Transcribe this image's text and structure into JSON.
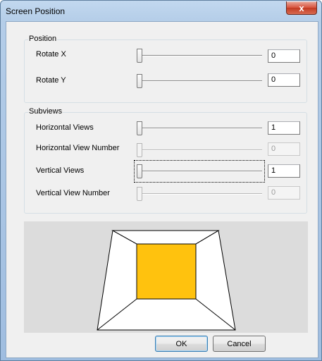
{
  "window": {
    "title": "Screen Position",
    "close_glyph": "x"
  },
  "position_group": {
    "title": "Position",
    "rows": [
      {
        "label": "Rotate X",
        "value": "0"
      },
      {
        "label": "Rotate Y",
        "value": "0"
      }
    ]
  },
  "subviews_group": {
    "title": "Subviews",
    "rows": [
      {
        "label": "Horizontal Views",
        "value": "1"
      },
      {
        "label": "Horizontal View Number",
        "value": "0"
      },
      {
        "label": "Vertical Views",
        "value": "1"
      },
      {
        "label": "Vertical View Number",
        "value": "0"
      }
    ]
  },
  "preview": {
    "screen_color": "#ffc20e",
    "background_color": "#dcdcdc"
  },
  "buttons": {
    "ok": "OK",
    "cancel": "Cancel"
  }
}
